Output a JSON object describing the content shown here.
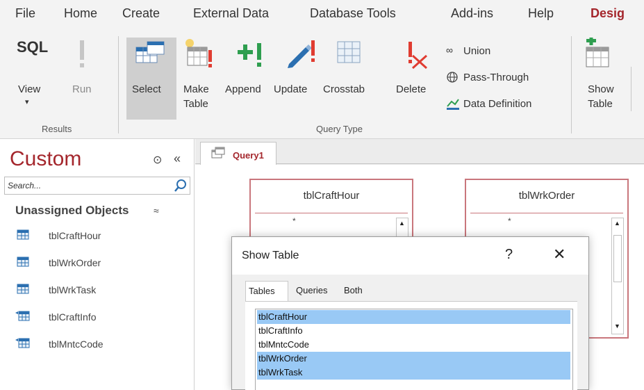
{
  "menu": [
    "File",
    "Home",
    "Create",
    "External Data",
    "Database Tools",
    "Add-ins",
    "Help",
    "Desig"
  ],
  "ribbon": {
    "results": {
      "view": {
        "line1": "SQL",
        "line2": "View",
        "arrow": "▾"
      },
      "run": "Run",
      "group_label": "Results"
    },
    "query_type": {
      "select": "Select",
      "make_table": {
        "line1": "Make",
        "line2": "Table"
      },
      "append": "Append",
      "update": "Update",
      "crosstab": "Crosstab",
      "delete": "Delete",
      "union": "Union",
      "pass_through": "Pass-Through",
      "data_definition": "Data Definition",
      "group_label": "Query Type"
    },
    "show_table": {
      "line1": "Show",
      "line2": "Table"
    }
  },
  "nav_pane": {
    "title": "Custom",
    "menu_glyph": "⊙",
    "collapse_glyph": "«",
    "search_placeholder": "Search...",
    "group": {
      "label": "Unassigned Objects",
      "toggle": "≈"
    },
    "items": [
      {
        "label": "tblCraftHour",
        "linked": false
      },
      {
        "label": "tblWrkOrder",
        "linked": false
      },
      {
        "label": "tblWrkTask",
        "linked": false
      },
      {
        "label": "tblCraftInfo",
        "linked": true
      },
      {
        "label": "tblMntcCode",
        "linked": true
      }
    ]
  },
  "document": {
    "tab_label": "Query1",
    "tables": [
      {
        "title": "tblCraftHour",
        "first_field": "*"
      },
      {
        "title": "tblWrkOrder",
        "first_field": "*"
      }
    ]
  },
  "dialog": {
    "title": "Show Table",
    "help": "?",
    "close": "✕",
    "tabs": [
      "Tables",
      "Queries",
      "Both"
    ],
    "active_tab": "Tables",
    "list": [
      {
        "label": "tblCraftHour",
        "selected": true
      },
      {
        "label": "tblCraftInfo",
        "selected": false
      },
      {
        "label": "tblMntcCode",
        "selected": false
      },
      {
        "label": "tblWrkOrder",
        "selected": true
      },
      {
        "label": "tblWrkTask",
        "selected": true
      }
    ]
  },
  "colors": {
    "accent": "#a4262c",
    "selection": "#99c9f5",
    "ribbon_bg": "#f3f3f3",
    "icon_green": "#2e9e4f",
    "icon_red": "#e03c31",
    "icon_blue": "#2b6fb0"
  }
}
